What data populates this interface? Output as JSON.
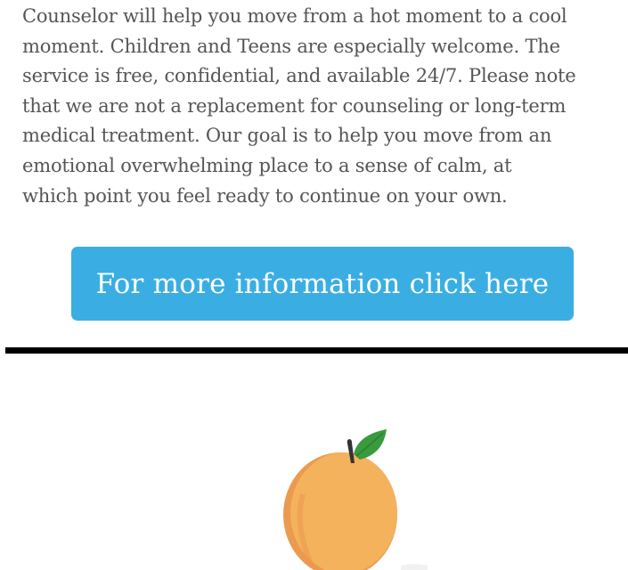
{
  "intro": {
    "lines": [
      "Counselor will help you move from a hot moment to a cool",
      "moment. Children and Teens are especially welcome. The",
      "service is free, confidential, and available 24/7. Please note",
      "that we are not a replacement for counseling or long-term",
      "medical treatment. Our goal is to help you move from an",
      "emotional overwhelming place to a sense of calm, at",
      "which point you feel ready to continue on your own."
    ]
  },
  "cta": {
    "label": "For more information click here"
  },
  "colors": {
    "text": "#555555",
    "button_bg": "#3aaee3",
    "button_text": "#ffffff",
    "divider": "#000000",
    "peach_body": "#f4b25c",
    "peach_shadow": "#eb9a4f",
    "leaf": "#3a9a3e",
    "stem": "#333333"
  },
  "logo": {
    "icon": "peach-icon"
  }
}
